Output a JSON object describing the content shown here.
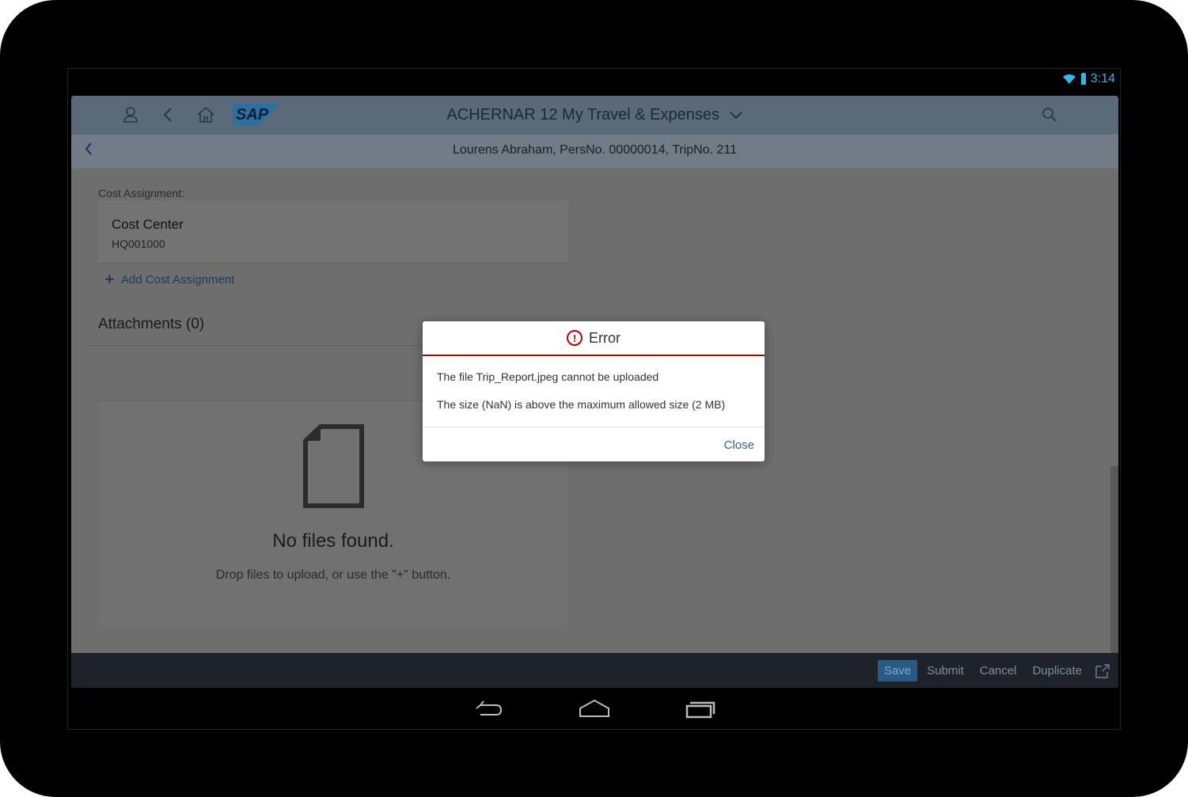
{
  "status_bar": {
    "time": "3:14"
  },
  "shell": {
    "title": "ACHERNAR 12 My Travel & Expenses",
    "logo": "SAP"
  },
  "subheader": {
    "title": "Lourens Abraham, PersNo. 00000014, TripNo. 211"
  },
  "cost_assignment": {
    "label": "Cost Assignment:",
    "item_name": "Cost Center",
    "item_value": "HQ001000",
    "add_label": "Add Cost Assignment"
  },
  "attachments": {
    "title": "Attachments (0)",
    "empty_title": "No files found.",
    "empty_hint": "Drop files to upload, or use the \"+\" button."
  },
  "footer": {
    "save": "Save",
    "submit": "Submit",
    "cancel": "Cancel",
    "duplicate": "Duplicate"
  },
  "dialog": {
    "title": "Error",
    "message1": "The file Trip_Report.jpeg cannot be uploaded",
    "message2": "The size (NaN) is above the maximum allowed size (2 MB)",
    "close": "Close"
  },
  "colors": {
    "error": "#bb0000",
    "accent": "#346187"
  }
}
